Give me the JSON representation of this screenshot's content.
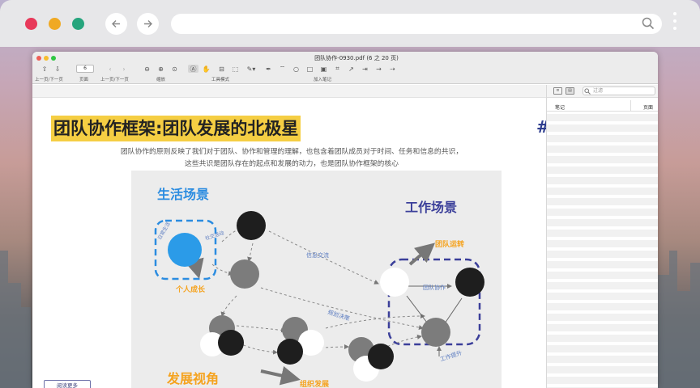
{
  "browser": {
    "back_icon": "arrow-left-icon",
    "forward_icon": "arrow-right-icon",
    "search_icon": "search-icon",
    "menu_icon": "kebab-menu-icon"
  },
  "window": {
    "title": "团队协作-0930.pdf (6 之 20 页)",
    "toolbar": {
      "page_value": "6",
      "labels": [
        "上一页/下一页",
        "页面",
        "上一页/下一页",
        "缩放",
        "工具模式",
        "加入笔记"
      ]
    }
  },
  "document": {
    "heading": "团队协作框架:团队发展的北极星",
    "hash_mark": "#",
    "subtitle_line1": "团队协作的原则反映了我们对于团队、协作和管理的理解，也包含着团队成员对于时间、任务和信息的共识，",
    "subtitle_line2": "这些共识是团队存在的起点和发展的动力，也是团队协作框架的核心",
    "mini_button": "阅读更多",
    "diagram": {
      "life_scene": "生活场景",
      "work_scene": "工作场景",
      "growth_view": "发展视角",
      "personal_growth": "个人成长",
      "team_operation": "团队运转",
      "org_development": "组织发展",
      "info_exchange": "信息交流",
      "team_collab": "团队协作",
      "planning_decision": "规划决策",
      "work_improve": "工作提升",
      "social_activity": "社交活动",
      "daily_life": "日常生活"
    }
  },
  "sidebar": {
    "search_placeholder": "过滤",
    "col_notes": "笔记",
    "col_page": "页面"
  },
  "colors": {
    "heading_highlight": "#f5ce43",
    "blue_title": "#2b8ce0",
    "purple_title": "#3b3f9a",
    "orange": "#f5a31f"
  }
}
